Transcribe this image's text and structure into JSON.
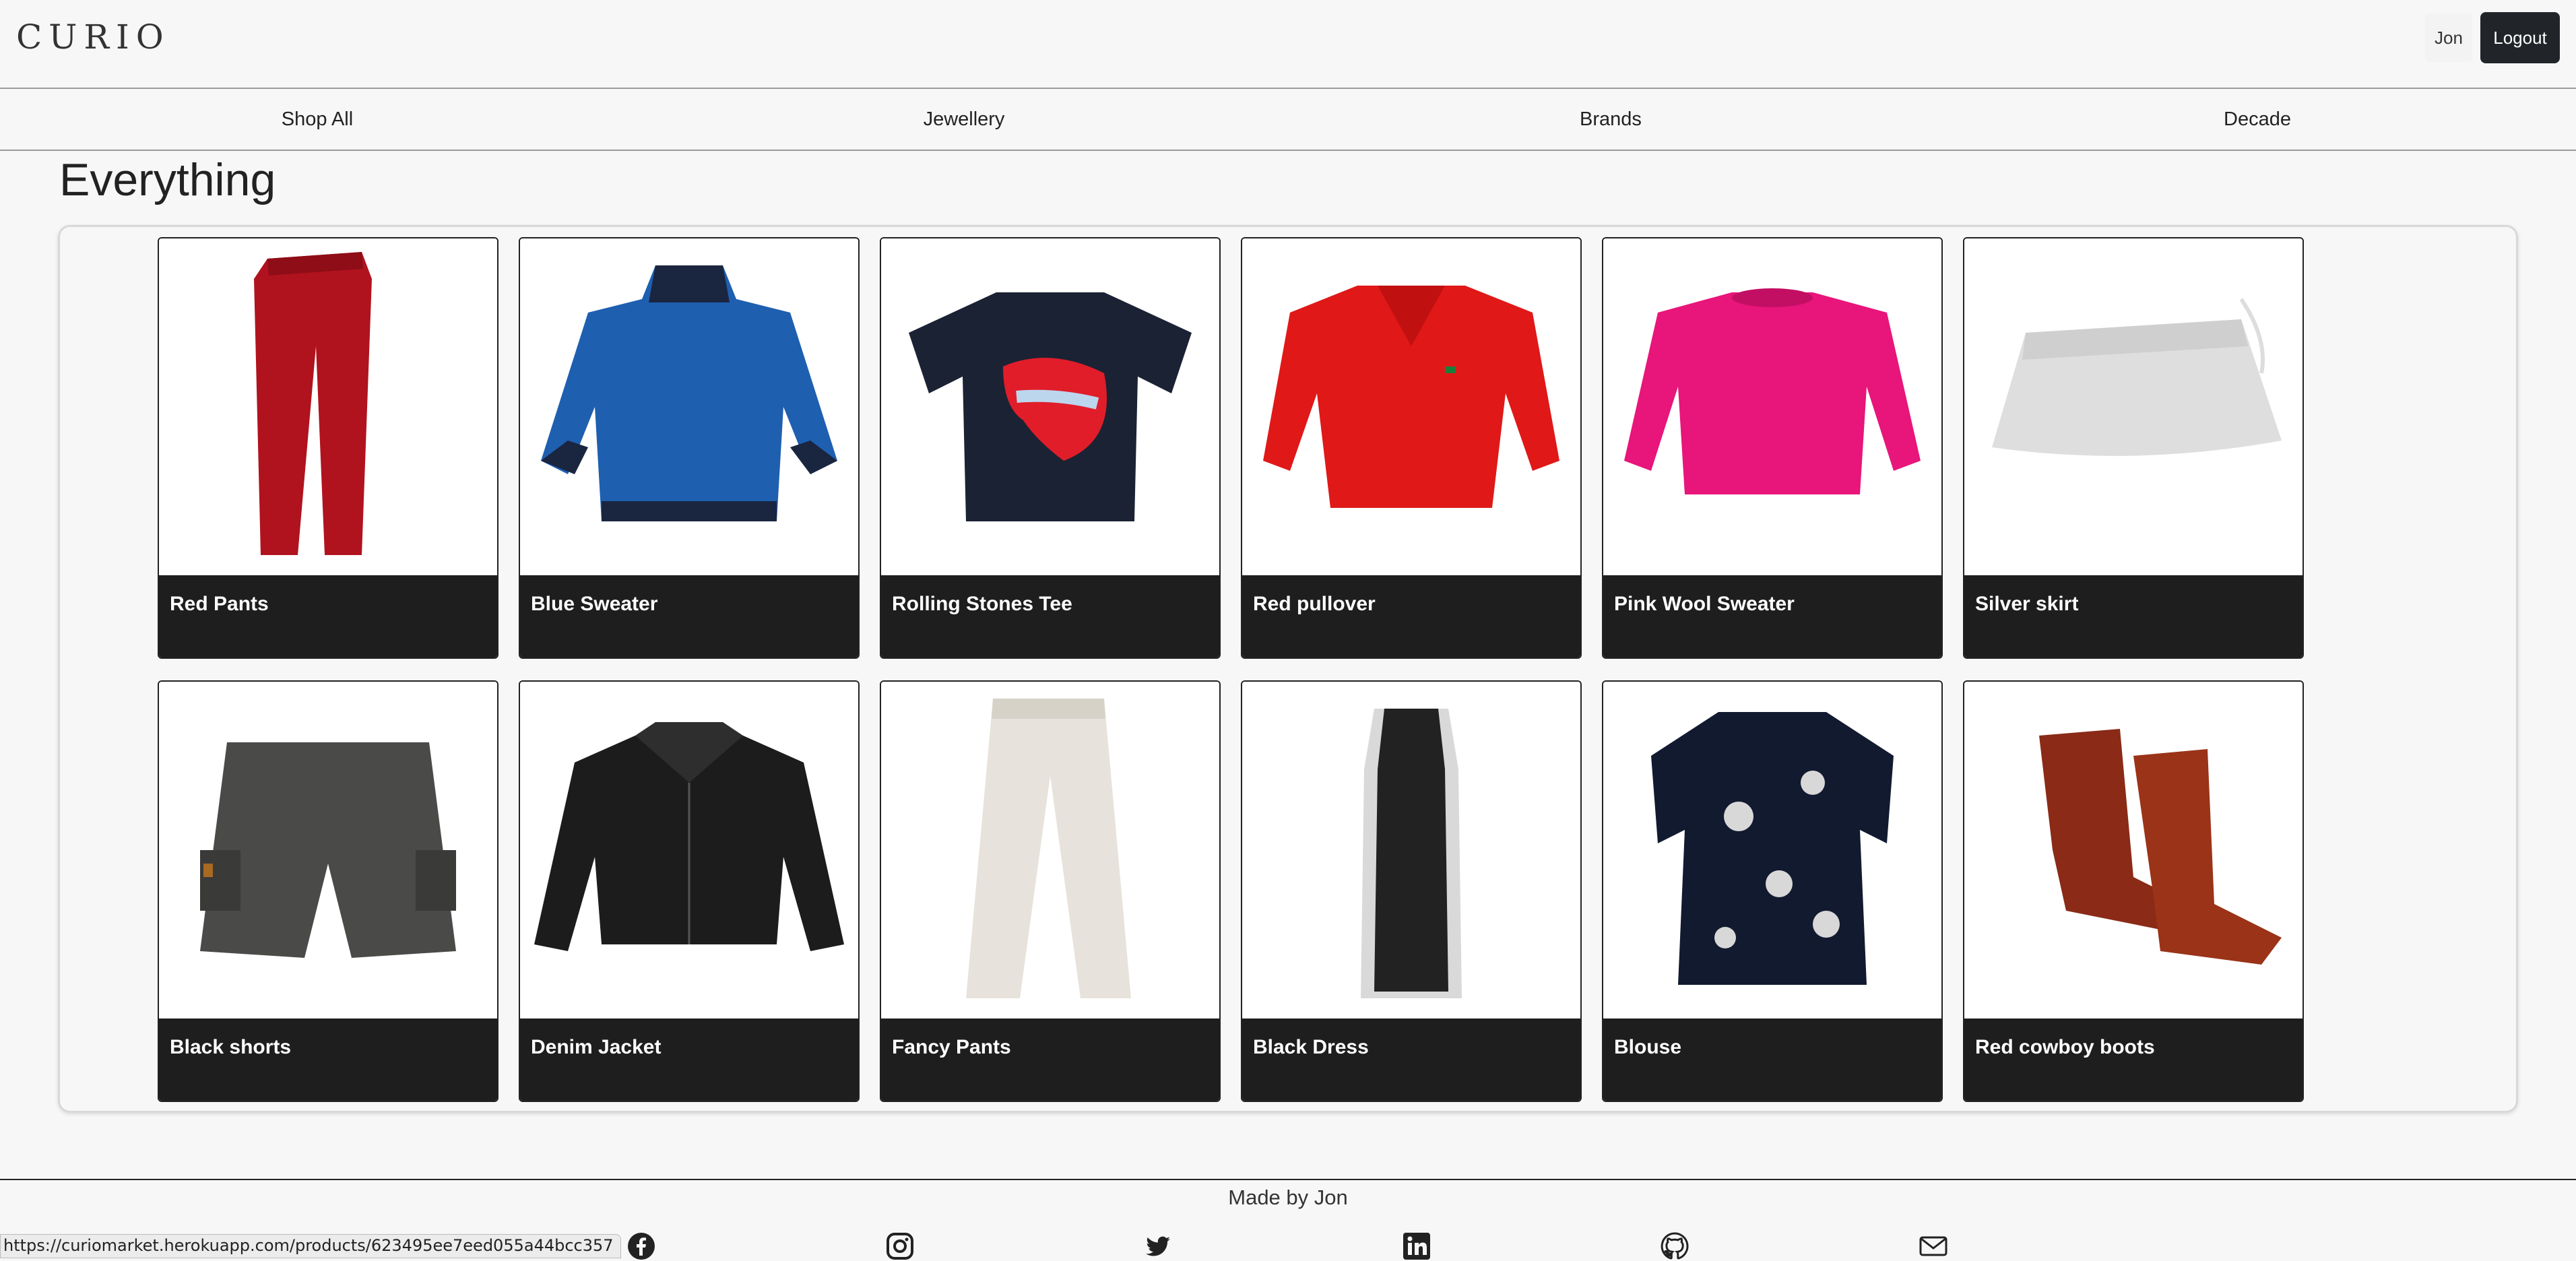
{
  "header": {
    "logo": "CURIO",
    "user_label": "Jon",
    "logout_label": "Logout"
  },
  "nav": {
    "items": [
      {
        "label": "Shop All"
      },
      {
        "label": "Jewellery"
      },
      {
        "label": "Brands"
      },
      {
        "label": "Decade"
      }
    ]
  },
  "main": {
    "title": "Everything",
    "products": [
      {
        "name": "Red Pants",
        "image": "red-pants",
        "color": "#b0131e"
      },
      {
        "name": "Blue Sweater",
        "image": "blue-sweater",
        "color": "#1e5fb0"
      },
      {
        "name": "Rolling Stones Tee",
        "image": "rolling-stones-tee",
        "color": "#1b2233"
      },
      {
        "name": "Red pullover",
        "image": "red-pullover",
        "color": "#e01818"
      },
      {
        "name": "Pink Wool Sweater",
        "image": "pink-wool-sweater",
        "color": "#e8157a"
      },
      {
        "name": "Silver skirt",
        "image": "silver-skirt",
        "color": "#dedede"
      },
      {
        "name": "Black shorts",
        "image": "black-shorts",
        "color": "#4a4a48"
      },
      {
        "name": "Denim Jacket",
        "image": "denim-jacket",
        "color": "#1c1c1c"
      },
      {
        "name": "Fancy Pants",
        "image": "fancy-pants",
        "color": "#e7e3dc"
      },
      {
        "name": "Black Dress",
        "image": "black-dress",
        "color": "#222222"
      },
      {
        "name": "Blouse",
        "image": "blouse",
        "color": "#121a30"
      },
      {
        "name": "Red cowboy boots",
        "image": "red-cowboy-boots",
        "color": "#8a2a17"
      }
    ]
  },
  "footer": {
    "credit": "Made by Jon",
    "social": [
      {
        "icon": "facebook-icon"
      },
      {
        "icon": "instagram-icon"
      },
      {
        "icon": "twitter-icon"
      },
      {
        "icon": "linkedin-icon"
      },
      {
        "icon": "github-icon"
      },
      {
        "icon": "mail-icon"
      }
    ]
  },
  "status_bar": {
    "url": "https://curiomarket.herokuapp.com/products/623495ee7eed055a44bcc357"
  }
}
